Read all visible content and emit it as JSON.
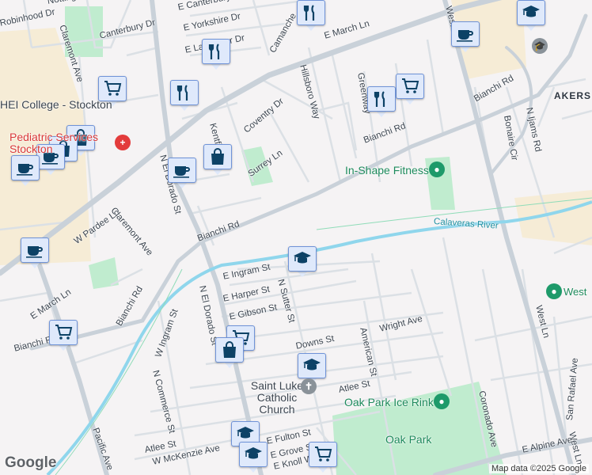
{
  "map": {
    "labels": [
      "Notting",
      "Robinhood Dr",
      "Claremont Ave",
      "Canterbury Dr",
      "E Canterbury Dr",
      "E Yorkshire Dr",
      "E Lancaster Dr",
      "Camanche",
      "E March Ln",
      "E March Ln",
      "Hillsboro Way",
      "Greenway",
      "Coventry Dr",
      "Kentfield",
      "N El Dorado St",
      "Surrey Ln",
      "W Pardee Ln",
      "Claremont Ave",
      "Bianchi Rd",
      "Bianchi Rd",
      "Bianchi Rd",
      "Bianchi Rd",
      "Bianchi Rd",
      "Bonaire Cir",
      "N Ijams Rd",
      "E Ingram St",
      "E Harper St",
      "E Gibson St",
      "N Sutter St",
      "W Ingram St",
      "N Commerce St",
      "Wright Ave",
      "Downs St",
      "American St",
      "Atlee St",
      "Atlee St",
      "W McKenzie Ave",
      "E Fulton St",
      "E Grove St",
      "E Knoll Way",
      "West Ln",
      "West Ln",
      "Coronado Ave",
      "San Rafael Ave",
      "E Alpine Ave",
      "Pacific Ave",
      "N El Dorado St",
      "Westway"
    ],
    "poi_labels": {
      "college": "HEI College - Stockton",
      "pediatrics": "Pediatric Services Stockton",
      "inshape": "In-Shape Fitness",
      "river": "Calaveras River",
      "church": "Saint Luke Catholic Church",
      "icerink": "Oak Park Ice Rink",
      "oakpark": "Oak Park",
      "west": "West",
      "akers": "AKERS"
    },
    "markers": [
      "restaurant-icon",
      "restaurant-icon",
      "shopping-cart-icon",
      "shopping-bag-icon",
      "shopping-bag-icon",
      "coffee-icon",
      "coffee-icon",
      "coffee-icon",
      "shopping-bag-icon",
      "coffee-icon",
      "coffee-icon",
      "school-icon",
      "shopping-cart-icon",
      "restaurant-icon",
      "shopping-cart-icon",
      "school-icon",
      "shopping-cart-icon",
      "shopping-bag-icon",
      "school-icon",
      "school-icon",
      "school-icon",
      "shopping-cart-icon",
      "restaurant-icon"
    ],
    "colors": {
      "marker_fill": "#dfe9fb",
      "marker_border": "#6f93d8",
      "icon": "#0d4266",
      "park": "#c0eccf",
      "river": "#8fd6ec",
      "road": "#d3d9df"
    },
    "attribution": "Map data ©2025 Google",
    "logo": "Google"
  }
}
